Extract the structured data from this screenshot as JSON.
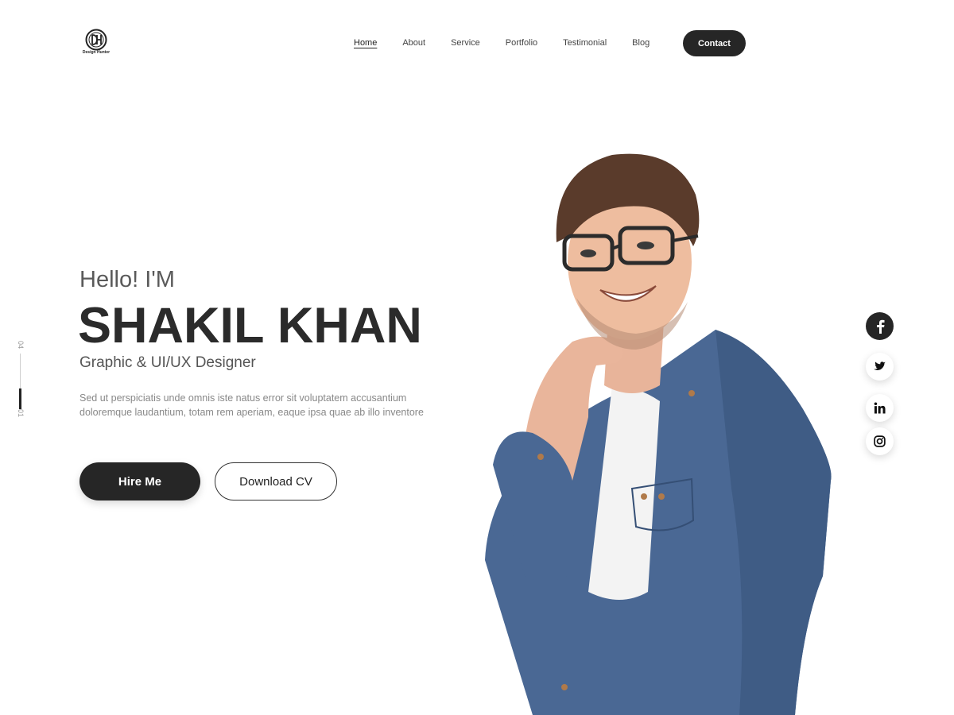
{
  "header": {
    "logo": {
      "initials": "DH",
      "text": "Design Hunter"
    },
    "nav": [
      {
        "label": "Home",
        "active": true
      },
      {
        "label": "About",
        "active": false
      },
      {
        "label": "Service",
        "active": false
      },
      {
        "label": "Portfolio",
        "active": false
      },
      {
        "label": "Testimonial",
        "active": false
      },
      {
        "label": "Blog",
        "active": false
      }
    ],
    "contact_label": "Contact"
  },
  "slide_indicator": {
    "current": "01",
    "total": "04",
    "progress_fraction": 0.25
  },
  "hero": {
    "greeting": "Hello! I'M",
    "name": "SHAKIL KHAN",
    "role": "Graphic & UI/UX Designer",
    "description": "Sed ut perspiciatis unde omnis iste natus error sit voluptatem accusantium doloremque laudantium, totam rem aperiam, eaque ipsa quae ab illo inventore",
    "hire_label": "Hire Me",
    "cv_label": "Download CV"
  },
  "social": [
    {
      "icon": "facebook-icon",
      "style": "dark"
    },
    {
      "icon": "twitter-icon",
      "style": "light"
    },
    {
      "icon": "linkedin-icon",
      "style": "light"
    },
    {
      "icon": "instagram-icon",
      "style": "light"
    }
  ],
  "colors": {
    "primary_dark": "#262626",
    "text_grey": "#888888",
    "shirt_blue": "#4a6894",
    "background": "#ffffff"
  }
}
